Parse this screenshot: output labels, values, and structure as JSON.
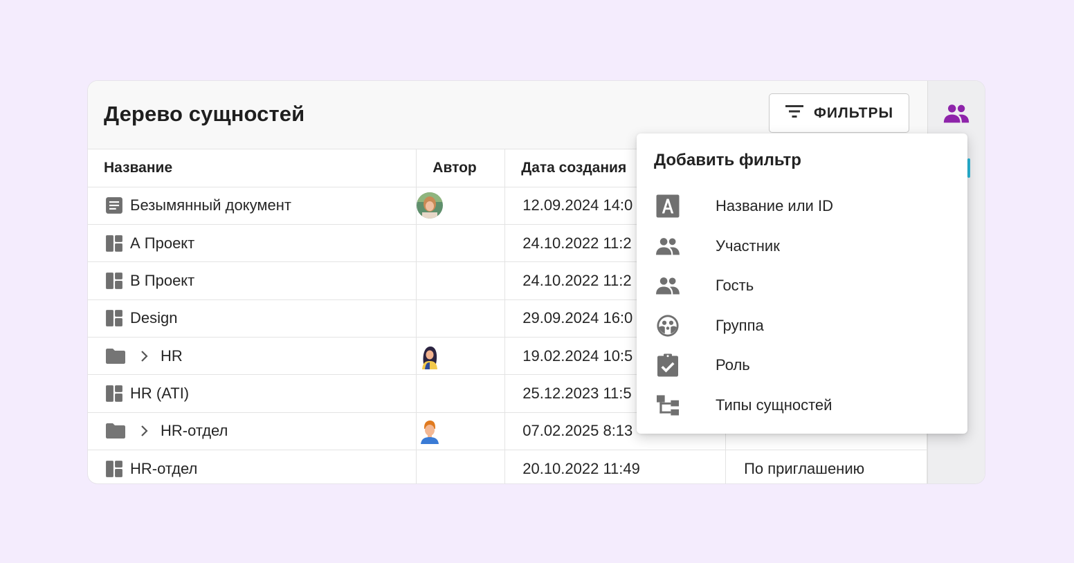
{
  "page": {
    "title": "Дерево сущностей",
    "filter_button": "ФИЛЬТРЫ"
  },
  "table": {
    "headers": [
      "Название",
      "Автор",
      "Дата создания",
      ""
    ],
    "rows": [
      {
        "icon": "document-icon",
        "expandable": false,
        "name": "Безымянный документ",
        "avatar": "avatar-woman-photo",
        "date": "12.09.2024 14:0",
        "access": ""
      },
      {
        "icon": "dashboard-icon",
        "expandable": false,
        "name": "А Проект",
        "avatar": "",
        "date": "24.10.2022 11:2",
        "access": ""
      },
      {
        "icon": "dashboard-icon",
        "expandable": false,
        "name": "В Проект",
        "avatar": "",
        "date": "24.10.2022 11:2",
        "access": ""
      },
      {
        "icon": "dashboard-icon",
        "expandable": false,
        "name": "Design",
        "avatar": "",
        "date": "29.09.2024 16:0",
        "access": ""
      },
      {
        "icon": "folder-icon",
        "expandable": true,
        "name": "HR",
        "avatar": "avatar-woman-illustration",
        "date": "19.02.2024 10:5",
        "access": ""
      },
      {
        "icon": "dashboard-icon",
        "expandable": false,
        "name": "HR (ATI)",
        "avatar": "",
        "date": "25.12.2023 11:5",
        "access": ""
      },
      {
        "icon": "folder-icon",
        "expandable": true,
        "name": "HR-отдел",
        "avatar": "avatar-man-illustration",
        "date": "07.02.2025 8:13",
        "access": ""
      },
      {
        "icon": "dashboard-icon",
        "expandable": false,
        "name": "HR-отдел",
        "avatar": "",
        "date": "20.10.2022 11:49",
        "access": "По приглашению"
      }
    ]
  },
  "dropdown": {
    "title": "Добавить фильтр",
    "items": [
      {
        "icon": "text-a-icon",
        "label": "Название или ID"
      },
      {
        "icon": "people-icon",
        "label": "Участник"
      },
      {
        "icon": "people-icon",
        "label": "Гость"
      },
      {
        "icon": "group-icon",
        "label": "Группа"
      },
      {
        "icon": "clipboard-check-icon",
        "label": "Роль"
      },
      {
        "icon": "tree-icon",
        "label": "Типы сущностей"
      }
    ]
  },
  "colors": {
    "background": "#f4ecfd",
    "accent_purple": "#8e24aa",
    "icon_gray": "#757575",
    "rail_accent": "#29b6d8"
  }
}
